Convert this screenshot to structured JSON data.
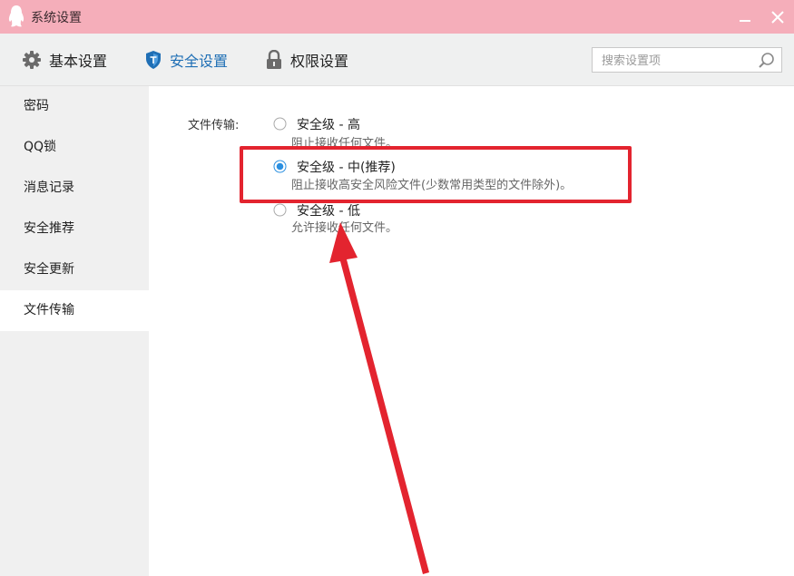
{
  "window": {
    "title": "系统设置",
    "icon": "qq-penguin-icon"
  },
  "tabs": [
    {
      "label": "基本设置",
      "icon": "gear-icon",
      "active": false
    },
    {
      "label": "安全设置",
      "icon": "shield-icon",
      "active": true
    },
    {
      "label": "权限设置",
      "icon": "lock-icon",
      "active": false
    }
  ],
  "search": {
    "placeholder": "搜索设置项",
    "icon": "search-icon"
  },
  "sidebar": {
    "items": [
      {
        "label": "密码"
      },
      {
        "label": "QQ锁"
      },
      {
        "label": "消息记录"
      },
      {
        "label": "安全推荐"
      },
      {
        "label": "安全更新"
      },
      {
        "label": "文件传输",
        "active": true
      }
    ]
  },
  "file_transfer": {
    "label": "文件传输:",
    "options": [
      {
        "title": "安全级 - 高",
        "desc": "阻止接收任何文件。",
        "selected": false
      },
      {
        "title": "安全级 - 中(推荐)",
        "desc": "阻止接收高安全风险文件(少数常用类型的文件除外)。",
        "selected": true
      },
      {
        "title": "安全级 - 低",
        "desc": "允许接收任何文件。",
        "selected": false
      }
    ]
  },
  "colors": {
    "titlebar": "#f5aeba",
    "accent_blue": "#1f6fb5",
    "annotation_red": "#e3242f"
  }
}
